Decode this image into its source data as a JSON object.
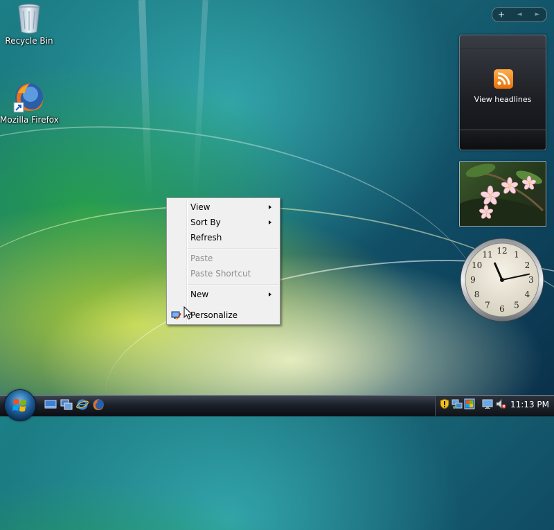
{
  "desktop": {
    "icons": [
      {
        "label": "Recycle Bin"
      },
      {
        "label": "Mozilla Firefox"
      }
    ]
  },
  "sidebar": {
    "controls": {
      "add": "+",
      "prev": "◄",
      "next": "►"
    },
    "feed_gadget": {
      "text": "View headlines"
    },
    "clock_gadget": {
      "numbers": [
        "12",
        "1",
        "2",
        "3",
        "4",
        "5",
        "6",
        "7",
        "8",
        "9",
        "10",
        "11"
      ],
      "time": "11:13"
    }
  },
  "context_menu": {
    "items": [
      {
        "label": "View",
        "has_submenu": true,
        "enabled": true
      },
      {
        "label": "Sort By",
        "has_submenu": true,
        "enabled": true
      },
      {
        "label": "Refresh",
        "has_submenu": false,
        "enabled": true
      },
      {
        "label": "Paste",
        "has_submenu": false,
        "enabled": false
      },
      {
        "label": "Paste Shortcut",
        "has_submenu": false,
        "enabled": false
      },
      {
        "label": "New",
        "has_submenu": true,
        "enabled": true
      },
      {
        "label": "Personalize",
        "has_submenu": false,
        "enabled": true,
        "icon": "personalize-icon"
      }
    ]
  },
  "taskbar": {
    "quick_launch": [
      "show-desktop-icon",
      "switch-windows-icon",
      "internet-explorer-icon",
      "firefox-icon"
    ],
    "tray_icons": [
      "security-shield-icon",
      "network-icon",
      "windows-update-icon",
      "display-icon",
      "volume-muted-icon"
    ],
    "clock": "11:13 PM"
  },
  "colors": {
    "accent": "#1d5f9b",
    "menu_bg": "#f0f0f0",
    "disabled_text": "#8d8d8d"
  }
}
